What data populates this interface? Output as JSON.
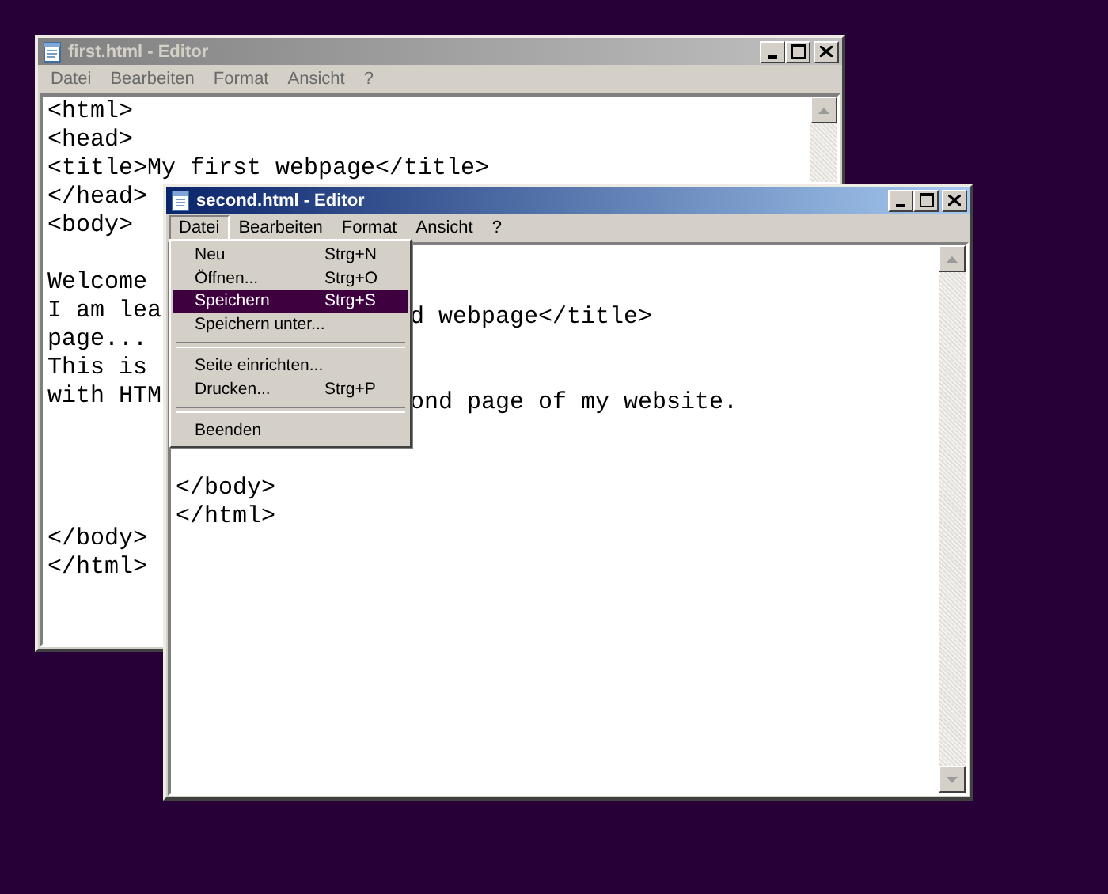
{
  "windows": [
    {
      "title": "first.html - Editor",
      "active": false,
      "menu": [
        "Datei",
        "Bearbeiten",
        "Format",
        "Ansicht",
        "?"
      ],
      "lines": [
        {
          "kind": "text",
          "text": "<html>"
        },
        {
          "kind": "text",
          "text": "<head>"
        },
        {
          "kind": "text",
          "text": "<title>My first webpage</title>"
        },
        {
          "kind": "text",
          "text": "</head>"
        },
        {
          "kind": "text",
          "text": "<body>"
        },
        {
          "kind": "blank"
        },
        {
          "kind": "text",
          "text": "Welcome"
        },
        {
          "kind": "text",
          "text": "I am lea"
        },
        {
          "kind": "text",
          "text": "page..."
        },
        {
          "kind": "text",
          "text": "This is"
        },
        {
          "kind": "text",
          "text": "with HTM"
        },
        {
          "kind": "blank"
        },
        {
          "kind": "blank"
        },
        {
          "kind": "blank"
        },
        {
          "kind": "blank"
        },
        {
          "kind": "text",
          "text": "</body>"
        },
        {
          "kind": "text",
          "text": "</html>"
        }
      ],
      "scroll_buttons": [
        {
          "kind": "up"
        }
      ]
    },
    {
      "title": "second.html - Editor",
      "active": true,
      "menu": [
        "Datei",
        "Bearbeiten",
        "Format",
        "Ansicht",
        "?"
      ],
      "lines": [
        {
          "kind": "blank"
        },
        {
          "kind": "blank"
        },
        {
          "kind": "covered",
          "text": "d webpage</title>"
        },
        {
          "kind": "blank"
        },
        {
          "kind": "blank"
        },
        {
          "kind": "covered",
          "text": "ond page of my website."
        },
        {
          "kind": "blank"
        },
        {
          "kind": "blank"
        },
        {
          "kind": "text",
          "text": "</body>"
        },
        {
          "kind": "text",
          "text": "</html>"
        }
      ],
      "scroll_buttons": [
        {
          "kind": "up"
        },
        {
          "kind": "down"
        }
      ],
      "open_menu": {
        "items": [
          {
            "kind": "item",
            "label": "Neu",
            "shortcut": "Strg+N",
            "selected": false
          },
          {
            "kind": "item",
            "label": "Öffnen...",
            "shortcut": "Strg+O",
            "selected": false
          },
          {
            "kind": "item",
            "label": "Speichern",
            "shortcut": "Strg+S",
            "selected": true
          },
          {
            "kind": "item",
            "label": "Speichern unter...",
            "selected": false
          },
          {
            "kind": "separator"
          },
          {
            "kind": "item",
            "label": "Seite einrichten...",
            "selected": false
          },
          {
            "kind": "item",
            "label": "Drucken...",
            "shortcut": "Strg+P",
            "selected": false
          },
          {
            "kind": "separator"
          },
          {
            "kind": "item",
            "label": "Beenden",
            "selected": false
          }
        ]
      }
    }
  ]
}
